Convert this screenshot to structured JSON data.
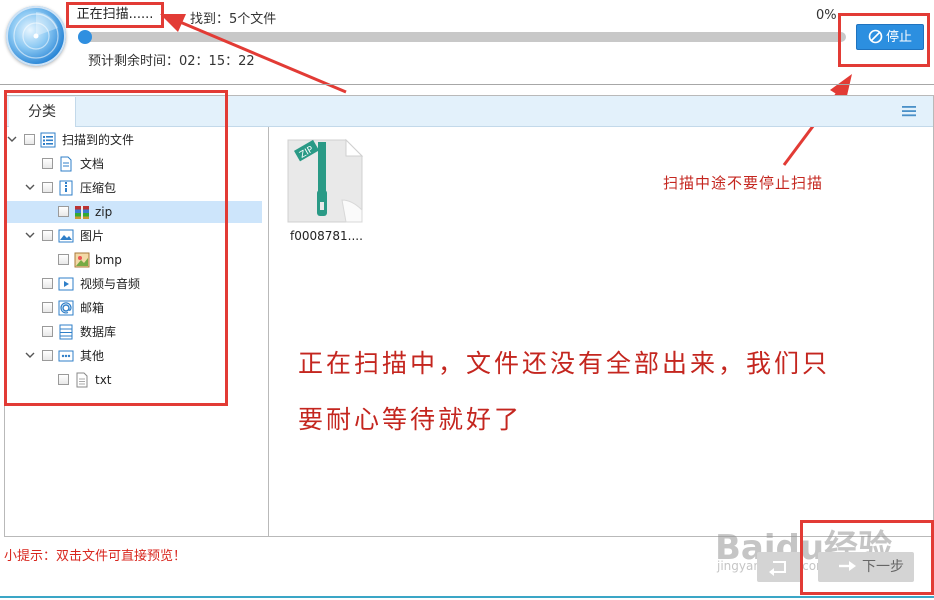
{
  "header": {
    "scan_status": "正在扫描......",
    "found": "找到：5个文件",
    "percent": "0%",
    "progress": 0,
    "remaining": "预计剩余时间：02：15：22",
    "stop_label": "停止"
  },
  "tabs": {
    "category": "分类"
  },
  "tree": [
    {
      "label": "扫描到的文件",
      "icon": "list-icon"
    },
    {
      "label": "文档",
      "icon": "document-icon"
    },
    {
      "label": "压缩包",
      "icon": "archive-icon"
    },
    {
      "label": "zip",
      "icon": "zip-icon",
      "selected": true
    },
    {
      "label": "图片",
      "icon": "image-icon"
    },
    {
      "label": "bmp",
      "icon": "bmp-icon"
    },
    {
      "label": "视频与音频",
      "icon": "video-icon"
    },
    {
      "label": "邮箱",
      "icon": "email-icon"
    },
    {
      "label": "数据库",
      "icon": "database-icon"
    },
    {
      "label": "其他",
      "icon": "more-icon"
    },
    {
      "label": "txt",
      "icon": "text-file-icon"
    }
  ],
  "files": [
    {
      "name": "f0008781....",
      "type_badge": "ZIP"
    }
  ],
  "annotations": {
    "stop_note": "扫描中途不要停止扫描",
    "scan_note_line1": "正在扫描中，文件还没有全部出来，我们只",
    "scan_note_line2": "要耐心等待就好了"
  },
  "footer": {
    "tip": "小提示：双击文件可直接预览！",
    "next_label": "下一步"
  },
  "watermark": {
    "brand": "Baidu经验",
    "url": "jingyan.baidu.com"
  },
  "colors": {
    "accent": "#2c8fe0",
    "annotation": "#e23b35",
    "selected_row": "#cde5fb"
  }
}
